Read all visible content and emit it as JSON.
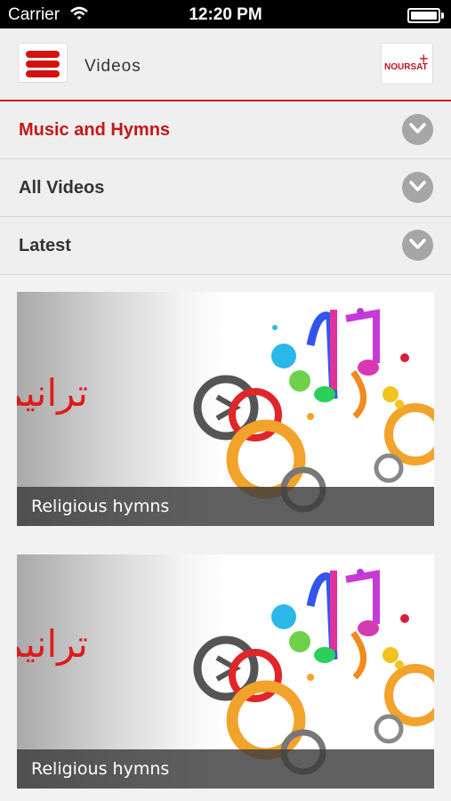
{
  "status_bar": {
    "carrier": "Carrier",
    "time": "12:20 PM"
  },
  "nav": {
    "title": "Videos",
    "logo_text": "NOURSAT",
    "logo_mark": "+"
  },
  "categories": [
    {
      "label": "Music and Hymns",
      "active": true
    },
    {
      "label": "All Videos",
      "active": false
    },
    {
      "label": "Latest",
      "active": false
    }
  ],
  "videos": [
    {
      "arabic_title": "ترانيم",
      "caption": "Religious hymns"
    },
    {
      "arabic_title": "ترانيم",
      "caption": "Religious hymns"
    }
  ],
  "colors": {
    "accent": "#c41717",
    "chevron": "#a6a6a6",
    "nav_bg": "#efefef"
  },
  "icons": [
    "wifi-icon",
    "battery-icon",
    "menu-icon",
    "chevron-down-icon",
    "play-icon"
  ]
}
